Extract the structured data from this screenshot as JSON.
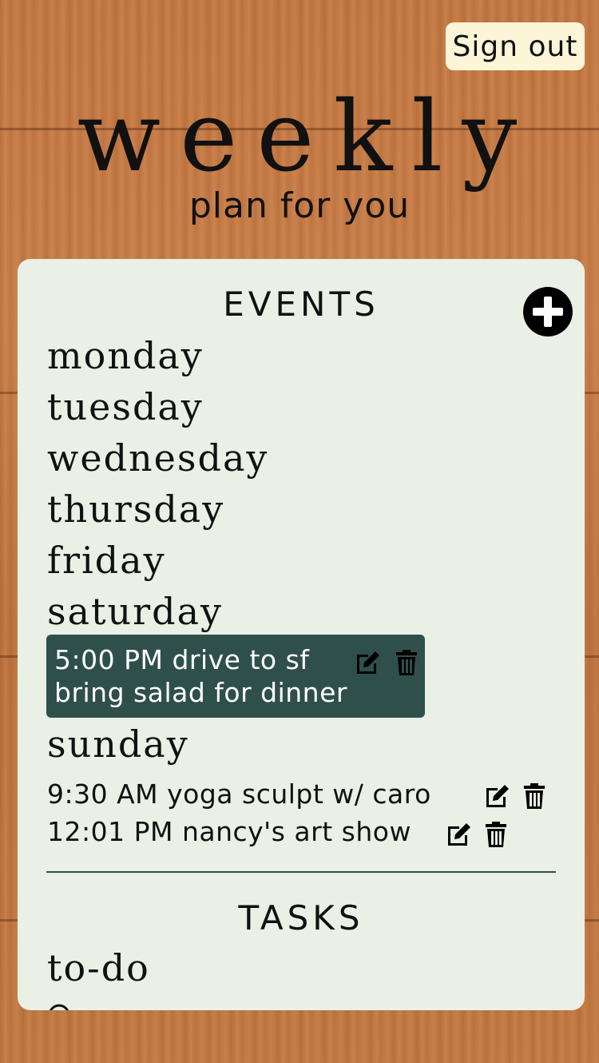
{
  "header": {
    "sign_out_label": "Sign out",
    "title": "weekly",
    "subtitle": "plan for you"
  },
  "events": {
    "heading": "EVENTS",
    "add_icon": "plus-circle-icon",
    "days": [
      "monday",
      "tuesday",
      "wednesday",
      "thursday",
      "friday",
      "saturday",
      "sunday"
    ],
    "saturday_items": [
      {
        "time_title": "5:00 PM drive to sf",
        "note": "bring salad for dinner"
      }
    ],
    "sunday_items": [
      {
        "text": "9:30 AM yoga sculpt w/ caro"
      },
      {
        "text": "12:01 PM nancy's art show"
      }
    ],
    "edit_icon": "edit-icon",
    "delete_icon": "trash-icon",
    "highlight_color": "#2f4f4b"
  },
  "tasks": {
    "heading": "TASKS",
    "group_label": "to-do"
  },
  "colors": {
    "panel_bg": "#eaf0e6",
    "signout_bg": "#fdf5d8",
    "accent": "#2f4f4b"
  }
}
